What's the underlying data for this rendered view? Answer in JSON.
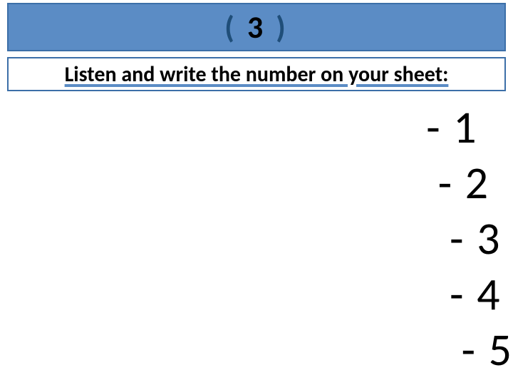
{
  "header": {
    "open_paren": "(",
    "number": " 3 ",
    "close_paren": ")"
  },
  "instruction": "Listen and write the number on your sheet:",
  "list_items": [
    "- 1",
    " - 2",
    "  - 3",
    "  - 4",
    "   - 5"
  ]
}
